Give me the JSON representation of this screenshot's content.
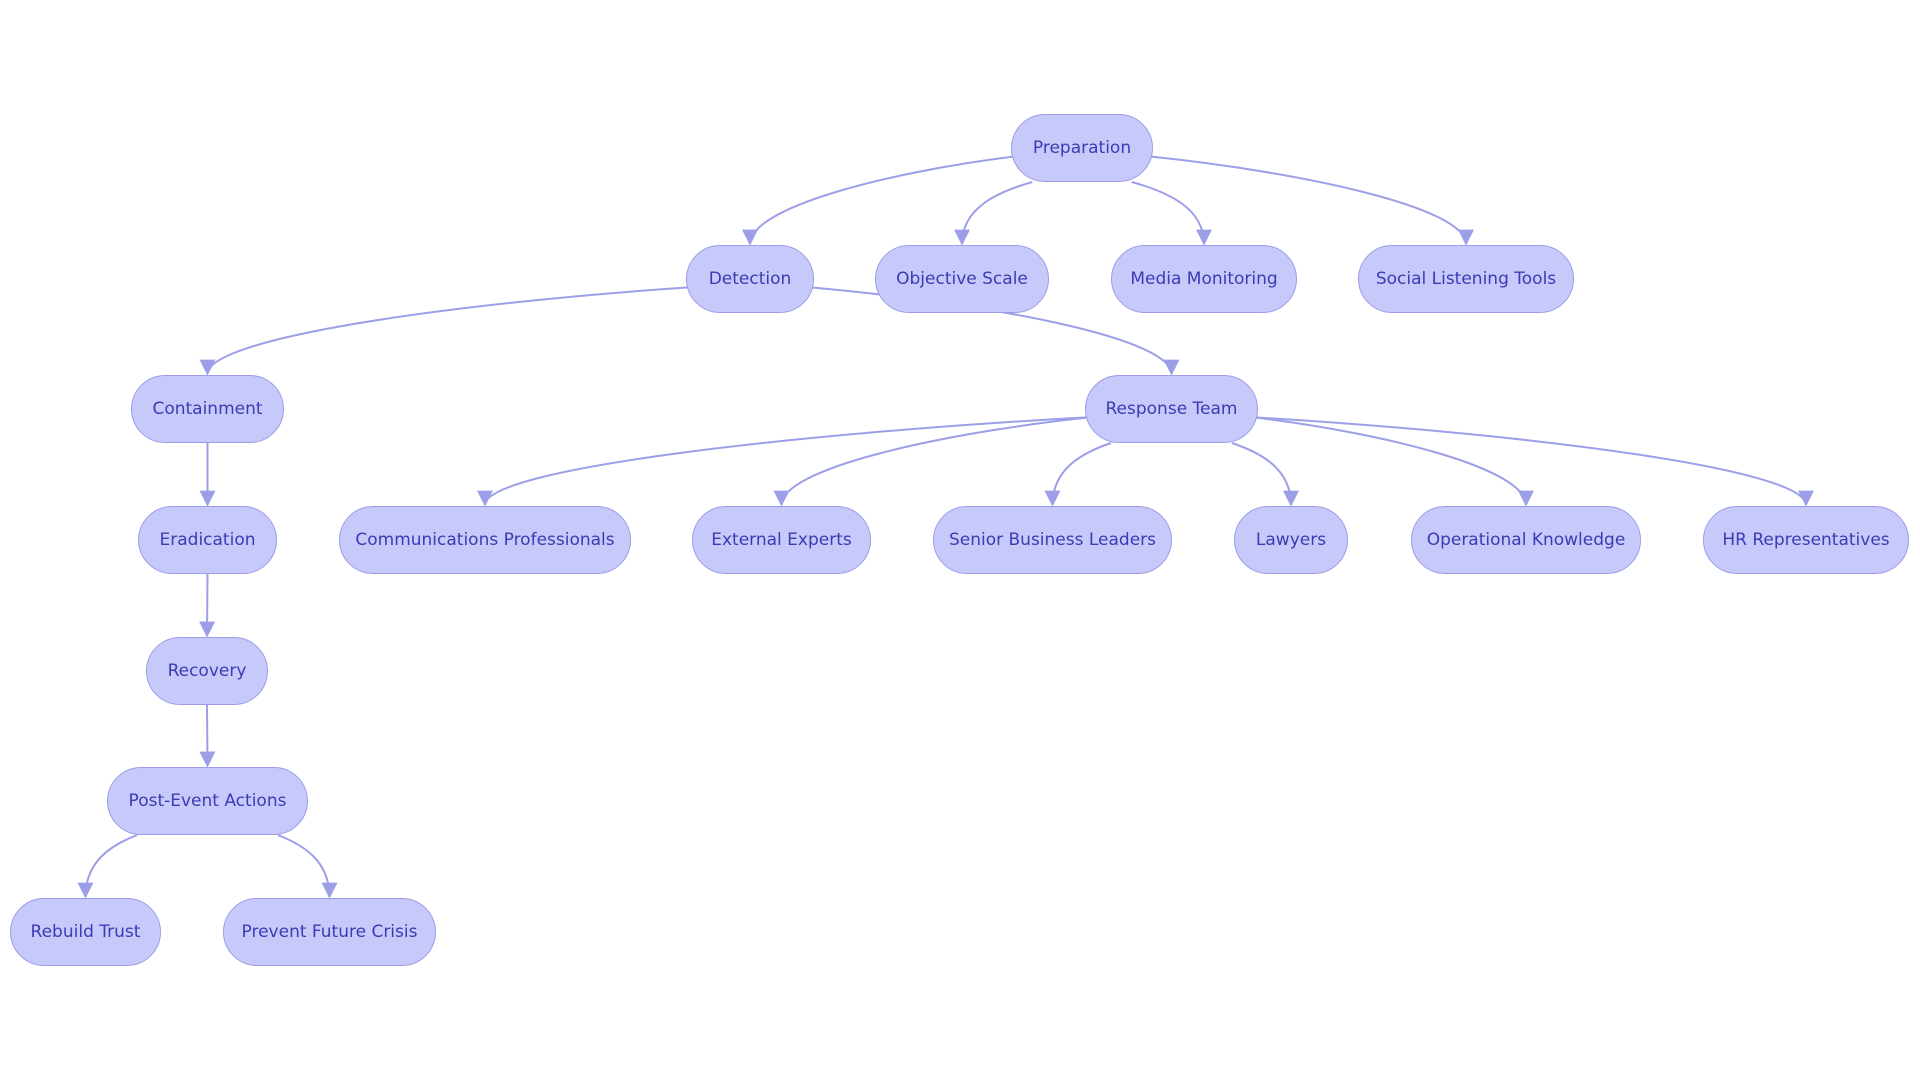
{
  "diagram": {
    "type": "flowchart",
    "colors": {
      "node_fill": "#c8c9fb",
      "node_stroke": "#9b9de6",
      "text": "#3b3bb3",
      "edge": "#9c9fe8"
    },
    "nodes": [
      {
        "id": "preparation",
        "label": "Preparation"
      },
      {
        "id": "detection",
        "label": "Detection"
      },
      {
        "id": "objective",
        "label": "Objective Scale"
      },
      {
        "id": "media",
        "label": "Media Monitoring"
      },
      {
        "id": "social",
        "label": "Social Listening Tools"
      },
      {
        "id": "containment",
        "label": "Containment"
      },
      {
        "id": "response",
        "label": "Response Team"
      },
      {
        "id": "eradication",
        "label": "Eradication"
      },
      {
        "id": "comms",
        "label": "Communications Professionals"
      },
      {
        "id": "external",
        "label": "External Experts"
      },
      {
        "id": "senior",
        "label": "Senior Business Leaders"
      },
      {
        "id": "lawyers",
        "label": "Lawyers"
      },
      {
        "id": "operational",
        "label": "Operational Knowledge"
      },
      {
        "id": "hr",
        "label": "HR Representatives"
      },
      {
        "id": "recovery",
        "label": "Recovery"
      },
      {
        "id": "postevent",
        "label": "Post-Event Actions"
      },
      {
        "id": "rebuild",
        "label": "Rebuild Trust"
      },
      {
        "id": "prevent",
        "label": "Prevent Future Crisis"
      }
    ],
    "edges": [
      {
        "from": "preparation",
        "to": "detection"
      },
      {
        "from": "preparation",
        "to": "objective"
      },
      {
        "from": "preparation",
        "to": "media"
      },
      {
        "from": "preparation",
        "to": "social"
      },
      {
        "from": "detection",
        "to": "containment"
      },
      {
        "from": "detection",
        "to": "response"
      },
      {
        "from": "containment",
        "to": "eradication"
      },
      {
        "from": "response",
        "to": "comms"
      },
      {
        "from": "response",
        "to": "external"
      },
      {
        "from": "response",
        "to": "senior"
      },
      {
        "from": "response",
        "to": "lawyers"
      },
      {
        "from": "response",
        "to": "operational"
      },
      {
        "from": "response",
        "to": "hr"
      },
      {
        "from": "eradication",
        "to": "recovery"
      },
      {
        "from": "recovery",
        "to": "postevent"
      },
      {
        "from": "postevent",
        "to": "rebuild"
      },
      {
        "from": "postevent",
        "to": "prevent"
      }
    ]
  }
}
